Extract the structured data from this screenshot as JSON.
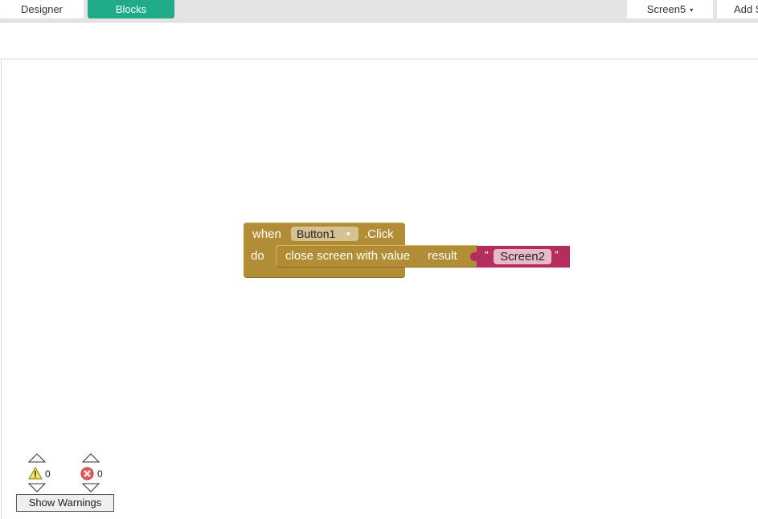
{
  "tabs": {
    "designer": "Designer",
    "blocks": "Blocks"
  },
  "screen_select": {
    "value": "Screen5",
    "caret": "▾"
  },
  "add_screen": {
    "label": "Add Screen"
  },
  "event_block": {
    "when": "when",
    "component": "Button1",
    "dropdown_caret": "▾",
    "event": ".Click",
    "do": "do",
    "color": "#b18e35"
  },
  "statement_block": {
    "label": "close screen with value",
    "arg_label": "result"
  },
  "text_block": {
    "open_quote": "“",
    "value": "Screen2",
    "close_quote": "”",
    "color": "#b32d5e"
  },
  "warnings": {
    "warning_count": "0",
    "error_count": "0",
    "show_warnings_label": "Show Warnings"
  },
  "icons": {
    "warning": "warning-icon",
    "error": "error-icon",
    "up": "arrow-up-icon",
    "down": "arrow-down-icon"
  },
  "colors": {
    "accent": "#1fab89"
  }
}
